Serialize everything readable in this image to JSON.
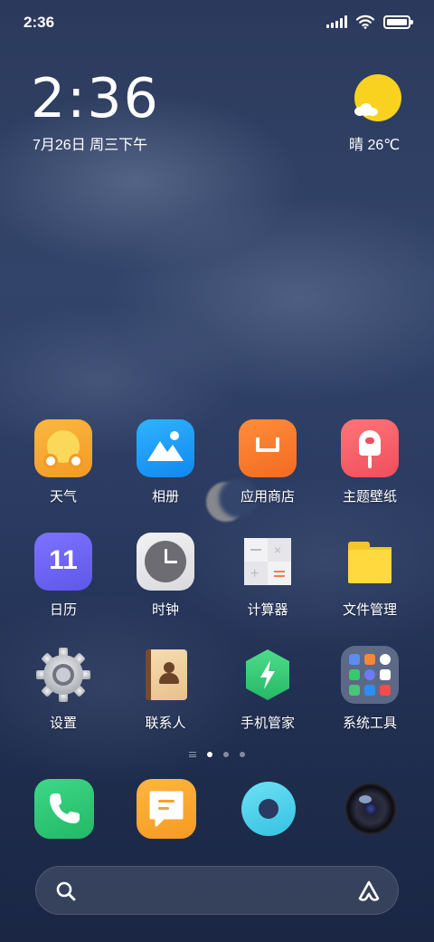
{
  "status_bar": {
    "time": "2:36",
    "battery_level": 1.0
  },
  "clock_widget": {
    "time": "2:36",
    "date": "7月26日 周三下午"
  },
  "weather_widget": {
    "text": "晴 26℃",
    "icon": "sunny-cloud-icon"
  },
  "apps": [
    {
      "label": "天气",
      "icon": "weather-icon"
    },
    {
      "label": "相册",
      "icon": "gallery-icon"
    },
    {
      "label": "应用商店",
      "icon": "app-store-icon"
    },
    {
      "label": "主题壁纸",
      "icon": "themes-icon"
    },
    {
      "label": "日历",
      "icon": "calendar-icon",
      "badge_text": "11"
    },
    {
      "label": "时钟",
      "icon": "clock-icon"
    },
    {
      "label": "计算器",
      "icon": "calculator-icon"
    },
    {
      "label": "文件管理",
      "icon": "file-manager-icon"
    },
    {
      "label": "设置",
      "icon": "settings-gear-icon"
    },
    {
      "label": "联系人",
      "icon": "contacts-icon"
    },
    {
      "label": "手机管家",
      "icon": "security-icon"
    },
    {
      "label": "系统工具",
      "icon": "system-tools-folder-icon"
    }
  ],
  "page_indicator": {
    "pages": 3,
    "current": 1
  },
  "dock": [
    {
      "icon": "phone-icon"
    },
    {
      "icon": "messages-icon"
    },
    {
      "icon": "browser-icon"
    },
    {
      "icon": "camera-icon"
    }
  ],
  "search_bar": {
    "left_icon": "search-icon",
    "right_icon": "assistant-icon"
  },
  "colors": {
    "weather_sun": "#f8d21e",
    "weather_app": "#f6a530",
    "gallery_app": "#1e9ef5",
    "app_store": "#f57b2a",
    "themes": "#f2626b",
    "calendar": "#6f66f0",
    "security": "#3fcf7c",
    "phone": "#2ecb77",
    "messages": "#f8a630",
    "browser": "#4fd1e8"
  }
}
